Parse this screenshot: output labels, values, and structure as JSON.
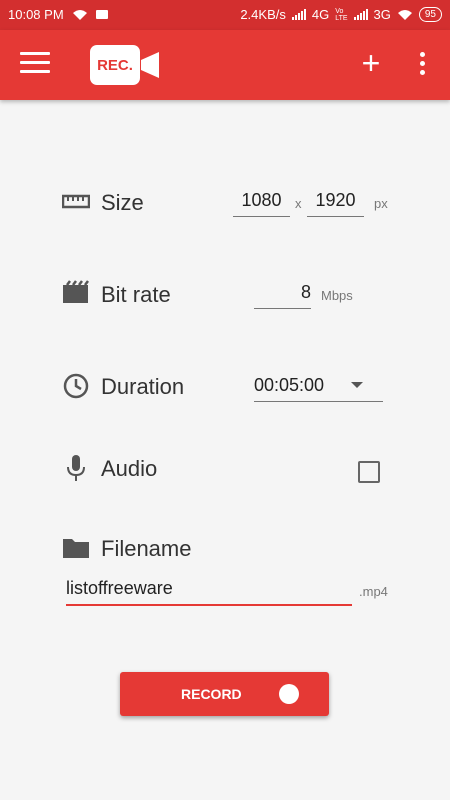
{
  "status_bar": {
    "time": "10:08 PM",
    "speed": "2.4KB/s",
    "network1": "4G",
    "network2": "3G",
    "battery": "95"
  },
  "app_bar": {
    "logo_text": "REC.",
    "menu_icon": "hamburger-menu-icon",
    "add_icon": "plus-icon",
    "more_icon": "more-vert-icon"
  },
  "settings": {
    "size": {
      "label": "Size",
      "width": "1080",
      "x_label": "x",
      "height": "1920",
      "unit": "px"
    },
    "bitrate": {
      "label": "Bit rate",
      "value": "8",
      "unit": "Mbps"
    },
    "duration": {
      "label": "Duration",
      "value": "00:05:00"
    },
    "audio": {
      "label": "Audio",
      "checked": false
    },
    "filename": {
      "label": "Filename",
      "value": "listoffreeware",
      "extension": ".mp4"
    }
  },
  "record_button": {
    "label": "RECORD"
  },
  "colors": {
    "primary": "#e53935",
    "status": "#d32f2f"
  }
}
